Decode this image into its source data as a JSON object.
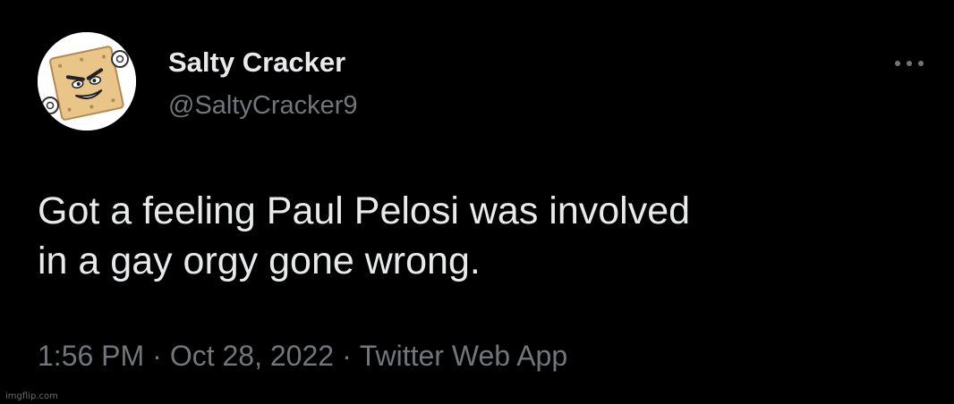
{
  "tweet": {
    "author": {
      "display_name": "Salty Cracker",
      "handle": "@SaltyCracker9",
      "avatar_icon": "cracker-mascot-avatar"
    },
    "more_icon": "more-horizontal-icon",
    "text_lines": [
      "Got a feeling Paul Pelosi was involved",
      "in a gay orgy gone wrong."
    ],
    "time": "1:56 PM",
    "separator": "·",
    "date": "Oct 28, 2022",
    "source": "Twitter Web App"
  },
  "watermark": "imgflip.com",
  "colors": {
    "background": "#000000",
    "primary_text": "#e7e9ea",
    "secondary_text": "#71767b"
  }
}
